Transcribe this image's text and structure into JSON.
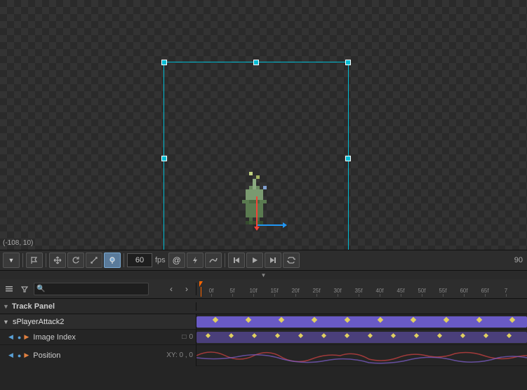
{
  "viewport": {
    "coord_display": "(-108, 10)",
    "checkerboard": true
  },
  "toolbar": {
    "fps_value": "60",
    "fps_label": "fps",
    "frame_count": "90",
    "snap_btn": "⊞",
    "move_btn": "✥",
    "rotate_btn": "↺",
    "scale_btn": "⤡",
    "pin_btn": "📌",
    "rewind_btn": "⏮",
    "play_btn": "▶",
    "forward_btn": "⏭",
    "loop_btn": "🔁",
    "link_btn": "🔗",
    "bolt_btn": "⚡",
    "curve_btn": "〜"
  },
  "bottom_panel": {
    "title": "Track Panel",
    "search_placeholder": "",
    "tracks": [
      {
        "id": "sPlayerAttack2",
        "name": "sPlayerAttack2",
        "type": "parent",
        "expanded": true,
        "children": [
          {
            "id": "image-index",
            "name": "Image Index",
            "value": "0",
            "has_keyframes": true
          },
          {
            "id": "position",
            "name": "Position",
            "value": "XY: 0 , 0",
            "has_keyframes": true,
            "is_wave": true
          }
        ]
      }
    ],
    "ruler_marks": [
      "0f",
      "5f",
      "10f",
      "15f",
      "20f",
      "25f",
      "30f",
      "35f",
      "40f",
      "45f",
      "50f",
      "55f",
      "60f",
      "65f",
      "7"
    ],
    "playhead_pos": "0f"
  },
  "icons": {
    "search": "🔍",
    "chevron_left": "‹",
    "chevron_right": "›",
    "expand": "▼",
    "collapse": "▶",
    "eye": "👁",
    "dot": "●",
    "diamond": "◆",
    "key_left": "◀",
    "key_right": "▶"
  }
}
